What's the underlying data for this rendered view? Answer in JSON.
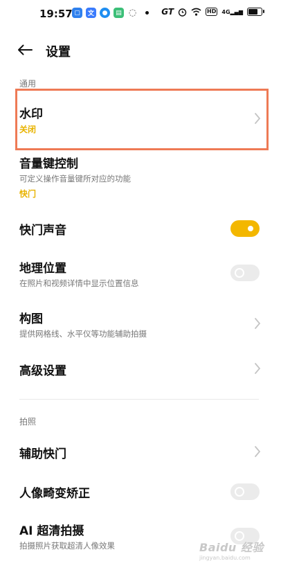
{
  "status_bar": {
    "time": "19:57",
    "app_icons": [
      {
        "name": "blue-app-icon",
        "color": "#2f80ed",
        "glyph": "▢"
      },
      {
        "name": "text-app-icon",
        "color": "#3a7bfd",
        "glyph": "文"
      },
      {
        "name": "blue-round-app-icon",
        "color": "#1f8ef1",
        "glyph": "●"
      },
      {
        "name": "green-app-icon",
        "color": "#3cbf78",
        "glyph": "▤"
      },
      {
        "name": "chat-app-icon",
        "color": "#555555",
        "glyph": "◌"
      }
    ],
    "gt_label": "GT",
    "hd_label": "HD",
    "signal_label": "4G"
  },
  "header": {
    "title": "设置"
  },
  "sections": {
    "general": "通用",
    "photo": "拍照"
  },
  "rows": {
    "watermark": {
      "title": "水印",
      "value": "关闭"
    },
    "volume_key": {
      "title": "音量键控制",
      "subtitle": "可定义操作音量键所对应的功能",
      "value": "快门"
    },
    "shutter_sound": {
      "title": "快门声音",
      "state": "on"
    },
    "location": {
      "title": "地理位置",
      "subtitle": "在照片和视频详情中显示位置信息",
      "state": "off"
    },
    "composition": {
      "title": "构图",
      "subtitle": "提供网格线、水平仪等功能辅助拍摄"
    },
    "advanced": {
      "title": "高级设置"
    },
    "assist_shutter": {
      "title": "辅助快门"
    },
    "portrait_correction": {
      "title": "人像畸变矫正",
      "state": "off"
    },
    "ai_hd": {
      "title": "AI 超清拍摄",
      "subtitle": "拍摄照片获取超清人像效果",
      "state": "off"
    }
  },
  "colors": {
    "accent": "#f3b700",
    "highlight_border": "#ee7a55"
  },
  "watermark_logo": "Baidu 经验",
  "watermark_logo_sub": "jingyan.baidu.com"
}
